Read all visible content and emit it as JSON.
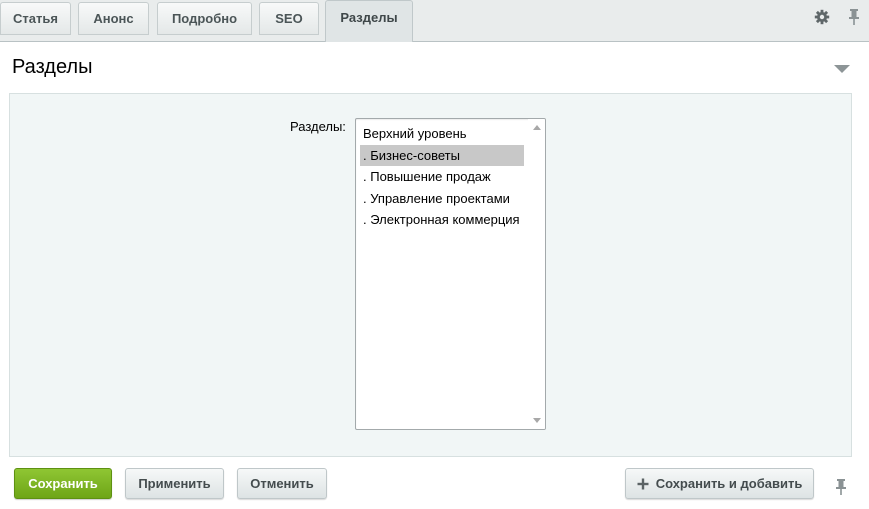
{
  "tabs": [
    {
      "label": "Статья",
      "active": false
    },
    {
      "label": "Анонс",
      "active": false
    },
    {
      "label": "Подробно",
      "active": false
    },
    {
      "label": "SEO",
      "active": false
    },
    {
      "label": "Разделы",
      "active": true
    }
  ],
  "tabbar_icons": [
    "gear-icon",
    "pin-icon"
  ],
  "section": {
    "title": "Разделы",
    "collapse_icon": "triangle-down-icon"
  },
  "field": {
    "label": "Разделы:",
    "options": [
      {
        "label": "Верхний уровень",
        "selected": false
      },
      {
        "label": ". Бизнес-советы",
        "selected": true
      },
      {
        "label": ". Повышение продаж",
        "selected": false
      },
      {
        "label": ". Управление проектами",
        "selected": false
      },
      {
        "label": ". Электронная коммерция",
        "selected": false
      }
    ]
  },
  "buttons": {
    "save": "Сохранить",
    "apply": "Применить",
    "cancel": "Отменить",
    "save_and_add": "Сохранить и добавить"
  },
  "colors": {
    "primary_button": "#7bb31f",
    "selected_option": "#c8c8c8",
    "panel_background": "#f1f6f6"
  }
}
